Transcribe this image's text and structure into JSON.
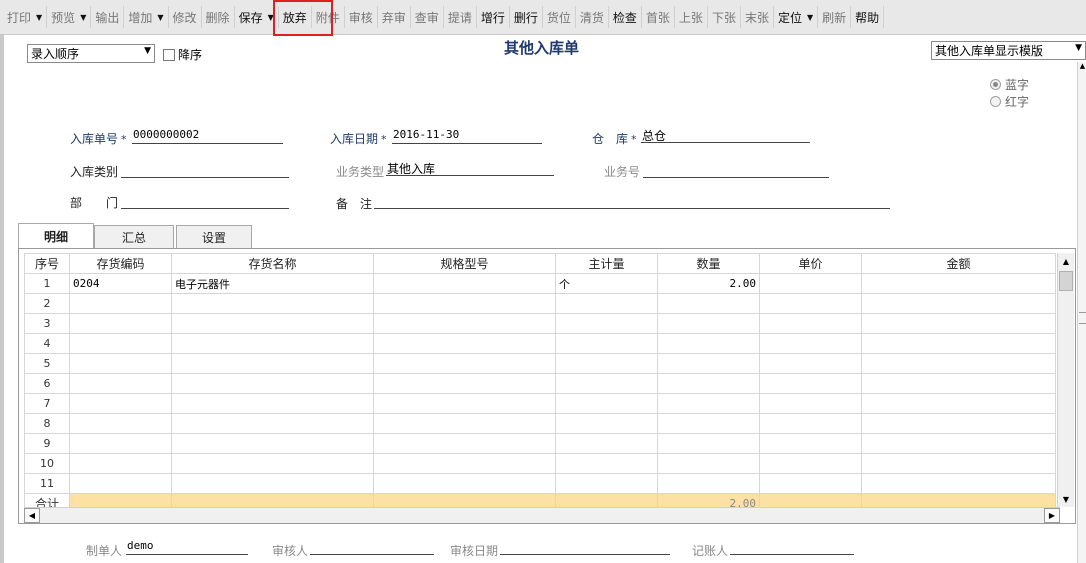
{
  "toolbar": {
    "items": [
      {
        "label": "打印",
        "dropdown": true,
        "enabled": false
      },
      {
        "label": "预览",
        "dropdown": true,
        "enabled": false
      },
      {
        "label": "输出",
        "dropdown": false,
        "enabled": false
      },
      {
        "label": "增加",
        "dropdown": true,
        "enabled": false
      },
      {
        "label": "修改",
        "dropdown": false,
        "enabled": false
      },
      {
        "label": "删除",
        "dropdown": false,
        "enabled": false
      },
      {
        "label": "保存",
        "dropdown": true,
        "enabled": true
      },
      {
        "label": "放弃",
        "dropdown": false,
        "enabled": true
      },
      {
        "label": "附件",
        "dropdown": false,
        "enabled": false
      },
      {
        "label": "审核",
        "dropdown": false,
        "enabled": false
      },
      {
        "label": "弃审",
        "dropdown": false,
        "enabled": false
      },
      {
        "label": "查审",
        "dropdown": false,
        "enabled": false
      },
      {
        "label": "提请",
        "dropdown": false,
        "enabled": false
      },
      {
        "label": "增行",
        "dropdown": false,
        "enabled": true
      },
      {
        "label": "删行",
        "dropdown": false,
        "enabled": true
      },
      {
        "label": "货位",
        "dropdown": false,
        "enabled": false
      },
      {
        "label": "清货",
        "dropdown": false,
        "enabled": false
      },
      {
        "label": "检查",
        "dropdown": false,
        "enabled": true
      },
      {
        "label": "首张",
        "dropdown": false,
        "enabled": false
      },
      {
        "label": "上张",
        "dropdown": false,
        "enabled": false
      },
      {
        "label": "下张",
        "dropdown": false,
        "enabled": false
      },
      {
        "label": "末张",
        "dropdown": false,
        "enabled": false
      },
      {
        "label": "定位",
        "dropdown": true,
        "enabled": true
      },
      {
        "label": "刷新",
        "dropdown": false,
        "enabled": false
      },
      {
        "label": "帮助",
        "dropdown": false,
        "enabled": true
      }
    ]
  },
  "header": {
    "order_select": "录入顺序",
    "desc_label": "降序",
    "title": "其他入库单",
    "template_select": "其他入库单显示模版",
    "radio_blue": "蓝字",
    "radio_red": "红字"
  },
  "form": {
    "doc_no_label": "入库单号",
    "doc_no": "0000000002",
    "date_label": "入库日期",
    "date": "2016-11-30",
    "warehouse_label": "仓　库",
    "warehouse": "总仓",
    "in_type_label": "入库类别",
    "in_type": "",
    "biz_type_label": "业务类型",
    "biz_type": "其他入库",
    "biz_no_label": "业务号",
    "biz_no": "",
    "dept_label": "部　　门",
    "dept": "",
    "remark_label": "备　注",
    "remark": ""
  },
  "tabs": [
    {
      "label": "明细",
      "active": true
    },
    {
      "label": "汇总",
      "active": false
    },
    {
      "label": "设置",
      "active": false
    }
  ],
  "grid": {
    "columns": [
      "序号",
      "存货编码",
      "存货名称",
      "规格型号",
      "主计量",
      "数量",
      "单价",
      "金额"
    ],
    "rows": [
      [
        "1",
        "0204",
        "电子元器件",
        "",
        "个",
        "2.00",
        "",
        ""
      ],
      [
        "2",
        "",
        "",
        "",
        "",
        "",
        "",
        ""
      ],
      [
        "3",
        "",
        "",
        "",
        "",
        "",
        "",
        ""
      ],
      [
        "4",
        "",
        "",
        "",
        "",
        "",
        "",
        ""
      ],
      [
        "5",
        "",
        "",
        "",
        "",
        "",
        "",
        ""
      ],
      [
        "6",
        "",
        "",
        "",
        "",
        "",
        "",
        ""
      ],
      [
        "7",
        "",
        "",
        "",
        "",
        "",
        "",
        ""
      ],
      [
        "8",
        "",
        "",
        "",
        "",
        "",
        "",
        ""
      ],
      [
        "9",
        "",
        "",
        "",
        "",
        "",
        "",
        ""
      ],
      [
        "10",
        "",
        "",
        "",
        "",
        "",
        "",
        ""
      ],
      [
        "11",
        "",
        "",
        "",
        "",
        "",
        "",
        ""
      ]
    ],
    "total": [
      "合计",
      "",
      "",
      "",
      "",
      "2.00",
      "",
      ""
    ]
  },
  "footer": {
    "maker_label": "制单人",
    "maker": "demo",
    "auditor_label": "审核人",
    "auditor": "",
    "audit_date_label": "审核日期",
    "audit_date": "",
    "bookkeeper_label": "记账人",
    "bookkeeper": ""
  },
  "colors": {
    "title": "#1f3a6e",
    "highlight_box": "#e02020",
    "total_row": "#fde1a4"
  }
}
